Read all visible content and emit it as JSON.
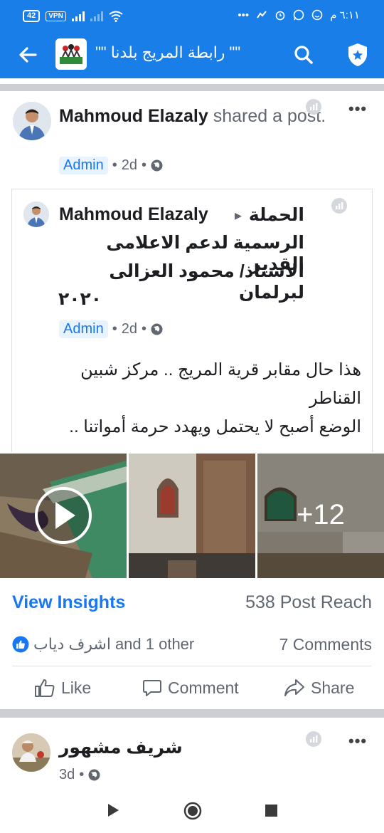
{
  "status_bar": {
    "battery": "42",
    "vpn": "VPN",
    "time": "٦:١١ م",
    "dots": "•••"
  },
  "app_bar": {
    "group_title": "\"\" رابطة المريج بلدنا \"\""
  },
  "post": {
    "author": "Mahmoud Elazaly",
    "action_text": "shared",
    "action_text2": "a post.",
    "badge": "Admin",
    "time": "2d",
    "dot": "•",
    "more": "•••"
  },
  "shared_post": {
    "author": "Mahmoud Elazaly",
    "arrow": "▸",
    "target_line1": "الحملة",
    "target_line2": "الرسمية لدعم  الاعلامى القدير",
    "target_line3": "الاستاذ/ محمود العزالى لبرلمان",
    "target_line4": "٢٠٢٠",
    "badge": "Admin",
    "time": "2d",
    "dot": "•",
    "body_line1": "هذا حال مقابر قرية المريج .. مركز شبين",
    "body_line2": "القناطر",
    "body_line3": "الوضع أصبح لا يحتمل ويهدد حرمة أمواتنا .."
  },
  "photos": {
    "more_count": "+12"
  },
  "stats": {
    "view_insights": "View Insights",
    "reach": "538 Post Reach",
    "reactor_name": "اشرف دياب",
    "reactor_rest": "and 1 other",
    "comments": "7 Comments"
  },
  "actions": {
    "like": "Like",
    "comment": "Comment",
    "share": "Share"
  },
  "next_post": {
    "author": "شريف مشهور",
    "time": "3d",
    "dot": "•",
    "more": "•••"
  },
  "colors": {
    "brand": "#1a7ee8",
    "link": "#1877f2",
    "text": "#1c1e21",
    "secondary": "#606770"
  }
}
